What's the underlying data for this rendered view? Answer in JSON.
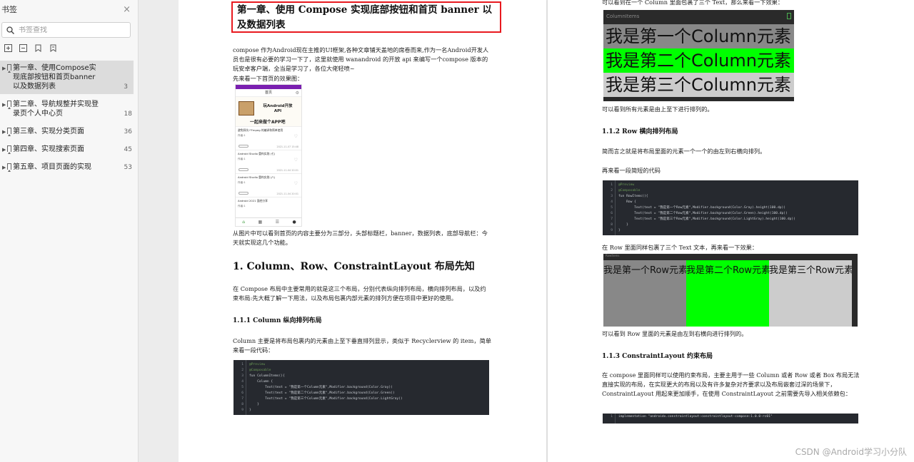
{
  "sidebar": {
    "title": "书签",
    "close_icon": "×",
    "search_placeholder": "书签查找",
    "bookmarks": [
      {
        "label": "第一章、使用Compose实现底部按钮和首页banner以及数据列表",
        "page": "3"
      },
      {
        "label": "第二章、导航规整并实现登录页个人中心页",
        "page": "18"
      },
      {
        "label": "第三章、实现分类页面",
        "page": "36"
      },
      {
        "label": "第四章、实现搜索页面",
        "page": "45"
      },
      {
        "label": "第五章、项目页面的实现",
        "page": "53"
      }
    ]
  },
  "page1": {
    "chapter_title": "第一章、使用 Compose 实现底部按钮和首页 banner 以及数据列表",
    "intro_1": "compose 作为Android现在主推的UI框架,各种文章铺天盖地的席卷而来,作为一名Android开发人员也是很有必要的学习一下了，这里就使用 wanandroid 的开放 api 来编写一个compose 版本的玩安卓客户端，全当是学习了，各位大佬轻喷~",
    "intro_2": "先来看一下首页的效果图：",
    "phone": {
      "title": "首页",
      "banner_line1": "玩Android开放API",
      "banner_line2": "一起来做个APP吧",
      "cards": [
        {
          "title": "避免踩坑 FFmpeg 的编译和简单使用",
          "author": "作者:1",
          "date": "2021-11-07 15:48"
        },
        {
          "title": "Android Studio 重构实践 (七)",
          "author": "作者:1",
          "date": "2021-11-04 20:01"
        },
        {
          "title": "Android Studio 重构实践 (八)",
          "author": "作者:1",
          "date": "2021-11-04 20:01"
        },
        {
          "title": "Android 2021 面经分享",
          "author": "作者:1",
          "date": ""
        }
      ]
    },
    "after_phone": "从图片中可以看到首页的内容主要分为三部分，头部标题栏，banner，数据列表，底部导航栏：今天就实现这几个功能。",
    "h1": "1. Column、Row、ConstraintLayout 布局先知",
    "h1_text": "在 Compose 布局中主要常用的就是这三个布局，分别代表纵向排列布局，横向排列布局，以及约束布局:先大概了解一下用法，以及布局包裹内部元素的排列方便在项目中更好的使用。",
    "h3": "1.1.1 Column 纵向排列布局",
    "h3_text": "Column 主要是将布局包裹内的元素由上至下垂直排列显示，类似于 Recyclerview 的 item，简单来看一段代码：",
    "code": [
      "@Preview",
      "@Composable",
      "fun ColumnItems(){",
      "    Column {",
      "        Text(text = \"我是第一个Column元素\",Modifier.background(Color.Gray))",
      "        Text(text = \"我是第二个Column元素\",Modifier.background(Color.Green))",
      "        Text(text = \"我是第三个Column元素\",Modifier.background(Color.LightGray))",
      "    }",
      "}"
    ]
  },
  "page2": {
    "top_text": "可以看到在一个 Column 里面包裹了三个 Text，那么来看一下效果：",
    "demo_column_label": "ColumnItems",
    "demo_column_items": [
      "我是第一个Column元素",
      "我是第二个Column元素",
      "我是第三个Column元素"
    ],
    "after_column": "可以看到所有元素是由上至下进行排列的。",
    "h3_row": "1.1.2 Row 横向排列布局",
    "row_text": "简而言之就是将布局里面的元素一个一个的由左到右横向排列。",
    "row_text2": "再来看一段简短的代码",
    "code_row": [
      "@Preview",
      "@Composable",
      "fun RowItems(){",
      "    Row {",
      "        Text(text = \"我是第一个Row元素\",Modifier.background(Color.Gray).height(100.dp))",
      "        Text(text = \"我是第二个Row元素\",Modifier.background(Color.Green).height(100.dp))",
      "        Text(text = \"我是第三个Row元素\",Modifier.background(Color.LightGray).height(100.dp))",
      "    }",
      "}"
    ],
    "row_demo_intro": "在 Row 里面同样包裹了三个 Text 文本，再来看一下效果：",
    "demo_row_label": "RowItems",
    "demo_row_items": [
      "我是第一个Row元素",
      "我是第二个Row元素",
      "我是第三个Row元素"
    ],
    "after_row": "可以看到 Row 里面的元素是由左到右横向进行排列的。",
    "h3_constraint": "1.1.3 ConstraintLayout 约束布局",
    "constraint_text": "在 compose 里面同样可以使用约束布局，主要主用于一些 Column 或者 Row 或者 Box 布局无法直接实现的布局，在实现更大的布局以及有许多复杂对齐要求以及布局嵌套过深的场景下，ConstraintLayout 用起来更加顺手，在使用 ConstraintLayout 之前需要先导入相关依赖包：",
    "code_dep": "implementation \"androidx.constraintlayout:constraintlayout-compose:1.0.0-rc01\""
  },
  "watermark": "CSDN @Android学习小分队",
  "colors": {
    "highlight_border": "#e8191f",
    "demo_gray": "#888888",
    "demo_green": "#00ff00",
    "demo_lightgray": "#cccccc",
    "code_bg": "#26292f"
  }
}
